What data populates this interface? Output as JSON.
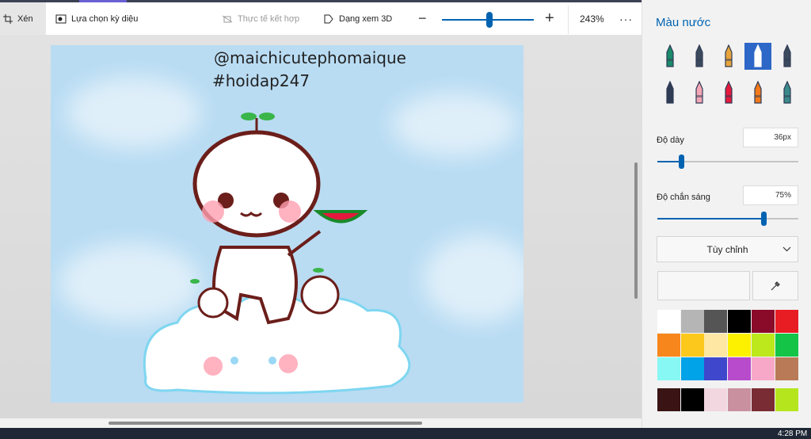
{
  "toolbar": {
    "crop_label": "Xén",
    "magic_select_label": "Lựa chọn kỳ diệu",
    "mixed_reality_label": "Thực tế kết hợp",
    "view_3d_label": "Dạng xem 3D",
    "zoom_level": "243%",
    "zoom_fraction": 0.52
  },
  "canvas": {
    "caption_line1": "@maichicutephomaique",
    "caption_line2": "#hoidap247"
  },
  "panel": {
    "title": "Màu nước",
    "tools": [
      {
        "name": "marker-tool-icon",
        "color": "#1a8a6a",
        "selected": false
      },
      {
        "name": "calligraphy-pen-tool-icon",
        "color": "#3b4a5c",
        "selected": false
      },
      {
        "name": "oil-brush-tool-icon",
        "color": "#e7a43b",
        "selected": false
      },
      {
        "name": "watercolor-brush-tool-icon",
        "color": "#ffffff",
        "selected": true
      },
      {
        "name": "pixel-pen-tool-icon",
        "color": "#3b4a5c",
        "selected": false
      },
      {
        "name": "pencil-tool-icon",
        "color": "#2f3b55",
        "selected": false
      },
      {
        "name": "eraser-tool-icon",
        "color": "#f4a6b5",
        "selected": false
      },
      {
        "name": "crayon-tool-icon",
        "color": "#e5193d",
        "selected": false
      },
      {
        "name": "spray-can-tool-icon",
        "color": "#f27a1a",
        "selected": false
      },
      {
        "name": "fill-bucket-tool-icon",
        "color": "#3a8a8a",
        "selected": false
      }
    ],
    "thickness_label": "Độ dày",
    "thickness_value": "36px",
    "thickness_fraction": 0.17,
    "opacity_label": "Độ chắn sáng",
    "opacity_value": "75%",
    "opacity_fraction": 0.75,
    "color_mode_label": "Tùy chỉnh",
    "palette": [
      "#ffffff",
      "#b5b5b5",
      "#555555",
      "#000000",
      "#8a0a2a",
      "#e81c23",
      "#f7871c",
      "#fcc81c",
      "#fde7a3",
      "#fdf100",
      "#bde81c",
      "#13c447",
      "#88f8f4",
      "#00a2e8",
      "#3f47cc",
      "#b84bcc",
      "#f7a8c8",
      "#b97a57"
    ],
    "custom_colors": [
      "#3a1414",
      "#000000",
      "#f2d7e0",
      "#c9909f",
      "#7a2c34",
      "#b5e61d"
    ]
  },
  "taskbar": {
    "clock": "4:28 PM"
  }
}
